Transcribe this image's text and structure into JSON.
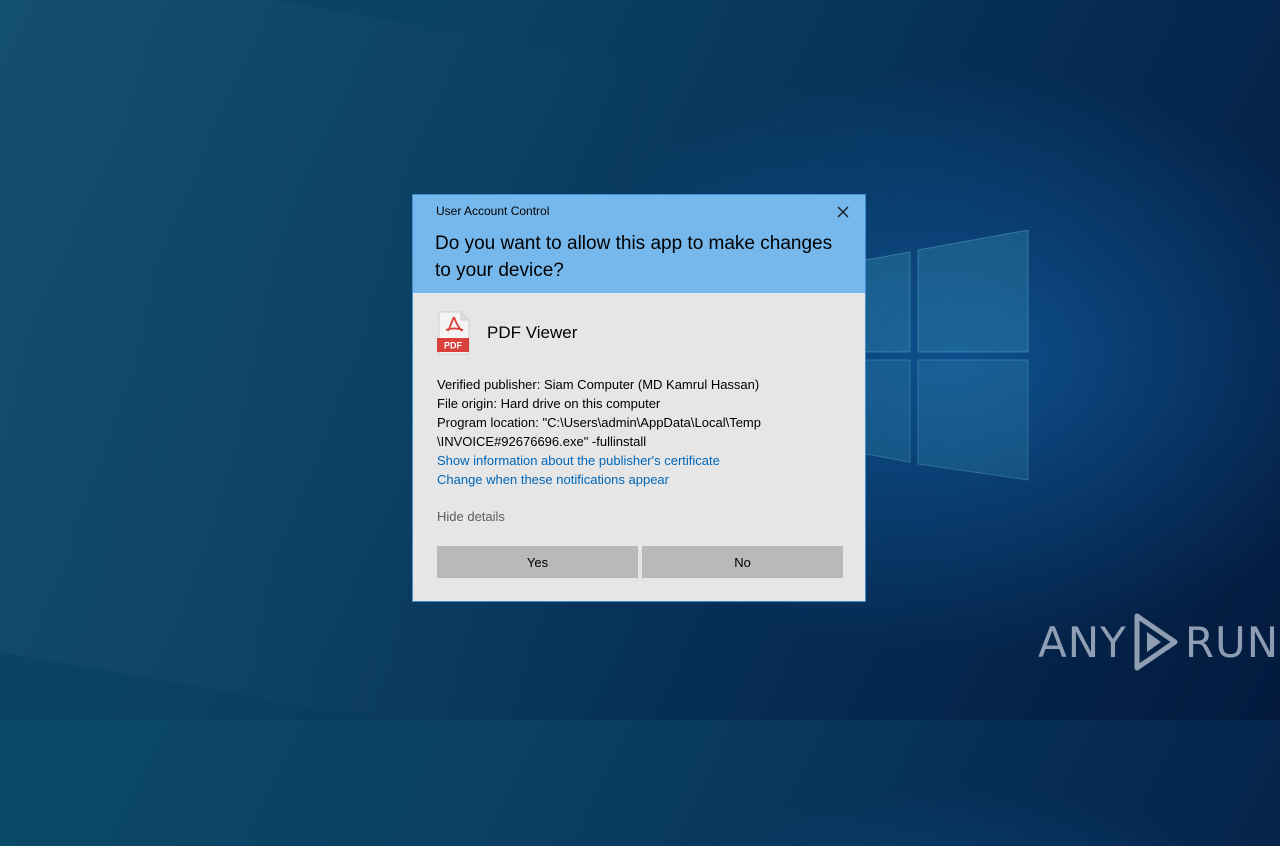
{
  "dialog": {
    "title": "User Account Control",
    "question": "Do you want to allow this app to make changes to your device?",
    "app_name": "PDF Viewer",
    "app_icon": "pdf-icon",
    "app_icon_label": "PDF",
    "publisher": "Verified publisher: Siam Computer (MD Kamrul Hassan)",
    "origin": "File origin: Hard drive on this computer",
    "location_line1": "Program location: \"C:\\Users\\admin\\AppData\\Local\\Temp",
    "location_line2": "\\INVOICE#92676696.exe\" -fullinstall",
    "cert_link": "Show information about the publisher's certificate",
    "notif_link": "Change when these notifications appear",
    "hide_details": "Hide details",
    "yes_label": "Yes",
    "no_label": "No"
  },
  "watermark": {
    "left": "ANY",
    "right": "RUN"
  },
  "colors": {
    "header": "#76b8ec",
    "body": "#e6e6e6",
    "link": "#0067b8",
    "button": "#b9b9b9",
    "pdf_red": "#d9413a"
  }
}
